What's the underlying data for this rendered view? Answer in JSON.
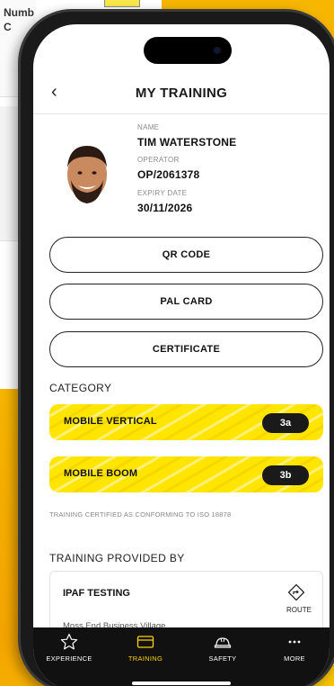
{
  "background": {
    "partial_label": "Numb\nC"
  },
  "header": {
    "title": "MY TRAINING",
    "back_icon": "chevron-left-icon"
  },
  "profile": {
    "name_label": "NAME",
    "name": "TIM WATERSTONE",
    "operator_label": "OPERATOR",
    "operator": "OP/2061378",
    "expiry_label": "EXPIRY DATE",
    "expiry": "30/11/2026"
  },
  "actions": {
    "qr_code": "QR CODE",
    "pal_card": "PAL CARD",
    "certificate": "CERTIFICATE"
  },
  "category": {
    "title": "CATEGORY",
    "items": [
      {
        "label": "MOBILE VERTICAL",
        "badge": "3a"
      },
      {
        "label": "MOBILE BOOM",
        "badge": "3b"
      }
    ],
    "note": "TRAINING CERTIFIED AS CONFORMING TO ISO 18878"
  },
  "provider": {
    "title": "TRAINING PROVIDED BY",
    "name": "IPAF TESTING",
    "address": "Moss End Business Village",
    "route_label": "ROUTE"
  },
  "tabs": [
    {
      "label": "EXPERIENCE",
      "icon": "star-icon",
      "active": false
    },
    {
      "label": "TRAINING",
      "icon": "card-icon",
      "active": true
    },
    {
      "label": "SAFETY",
      "icon": "hard-hat-icon",
      "active": false
    },
    {
      "label": "MORE",
      "icon": "ellipsis-icon",
      "active": false
    }
  ],
  "colors": {
    "accent": "#ffd400",
    "tabbar": "#111111",
    "category_bg": "#ffe500"
  }
}
